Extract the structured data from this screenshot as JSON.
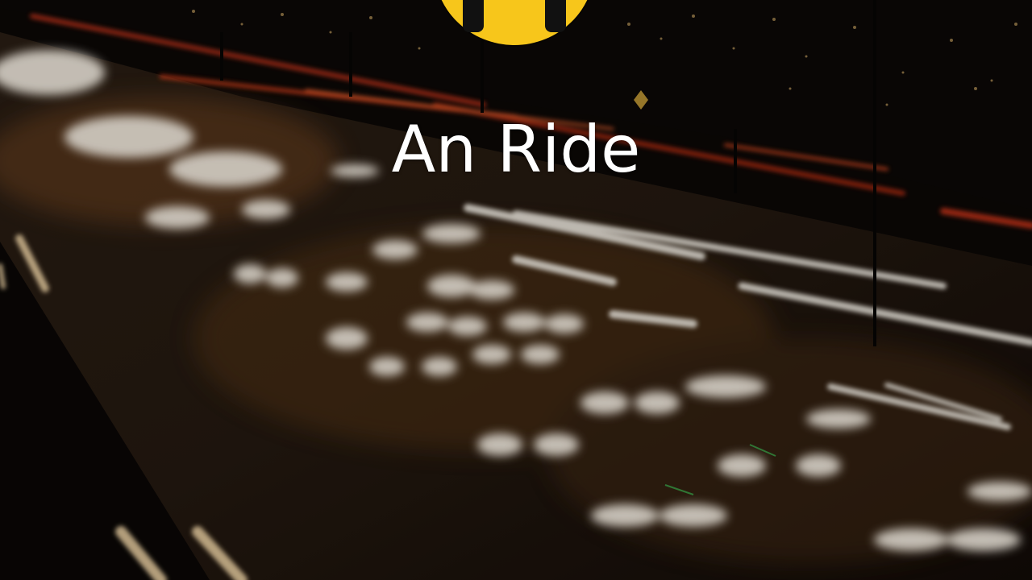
{
  "app": {
    "title": "An Ride"
  },
  "icons": {
    "logo": "taxi-logo-icon"
  },
  "colors": {
    "logo_yellow": "#f7c61b",
    "title_text": "#ffffff",
    "background": "#0a0604"
  }
}
